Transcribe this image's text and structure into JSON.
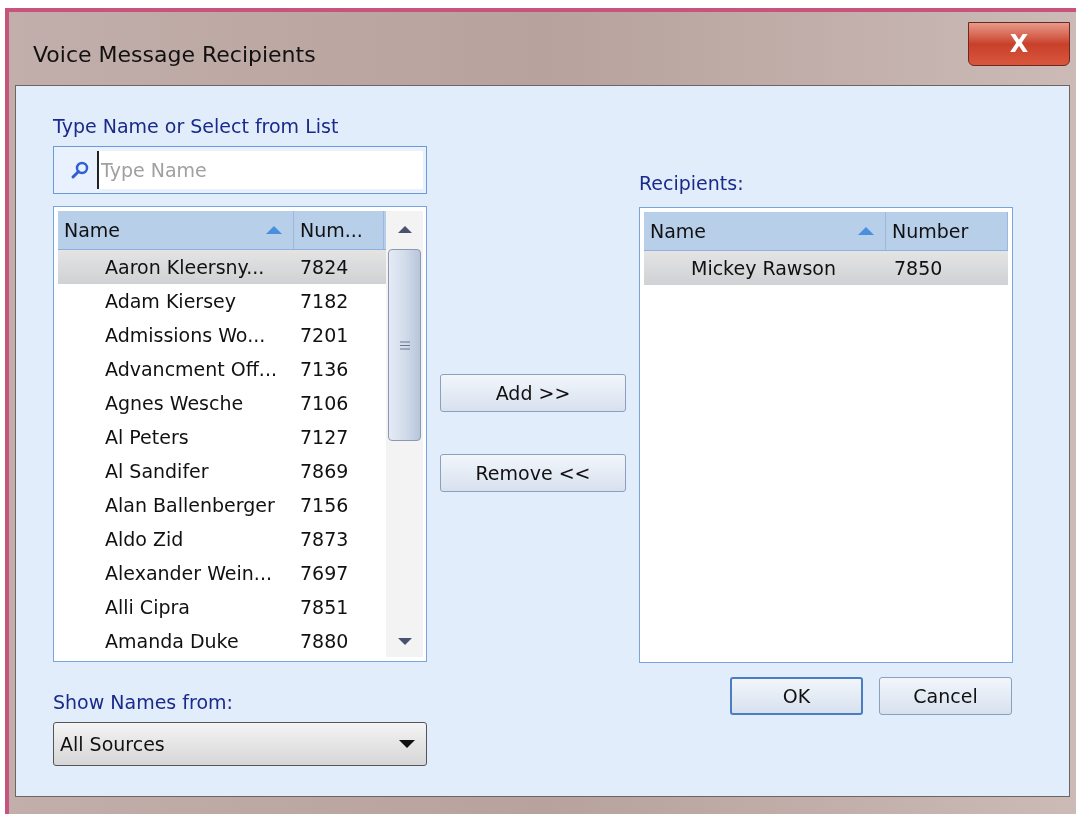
{
  "window": {
    "title": "Voice Message Recipients",
    "close": "X"
  },
  "directory": {
    "label": "Type Name or Select from List",
    "search": {
      "placeholder": "Type Name"
    },
    "columns": [
      {
        "label": "Name",
        "sorted": true
      },
      {
        "label": "Num...",
        "sorted": false
      }
    ],
    "rows": [
      {
        "name": "Aaron Kleersny...",
        "number": "7824",
        "selected": true
      },
      {
        "name": "Adam Kiersey",
        "number": "7182",
        "selected": false
      },
      {
        "name": "Admissions Wo...",
        "number": "7201",
        "selected": false
      },
      {
        "name": "Advancment Off...",
        "number": "7136",
        "selected": false
      },
      {
        "name": "Agnes Wesche",
        "number": "7106",
        "selected": false
      },
      {
        "name": "Al Peters",
        "number": "7127",
        "selected": false
      },
      {
        "name": "Al Sandifer",
        "number": "7869",
        "selected": false
      },
      {
        "name": "Alan Ballenberger",
        "number": "7156",
        "selected": false
      },
      {
        "name": "Aldo Zid",
        "number": "7873",
        "selected": false
      },
      {
        "name": "Alexander Wein...",
        "number": "7697",
        "selected": false
      },
      {
        "name": "Alli Cipra",
        "number": "7851",
        "selected": false
      },
      {
        "name": "Amanda Duke",
        "number": "7880",
        "selected": false
      }
    ]
  },
  "actions": [
    "Add >>",
    "Remove <<"
  ],
  "recipients": {
    "label": "Recipients:",
    "columns": [
      {
        "label": "Name",
        "sorted": true
      },
      {
        "label": "Number",
        "sorted": false
      }
    ],
    "rows": [
      {
        "name": "Mickey Rawson",
        "number": "7850",
        "selected": true
      }
    ]
  },
  "source": {
    "label": "Show Names from:",
    "value": "All Sources"
  },
  "buttons": [
    "OK",
    "Cancel"
  ]
}
